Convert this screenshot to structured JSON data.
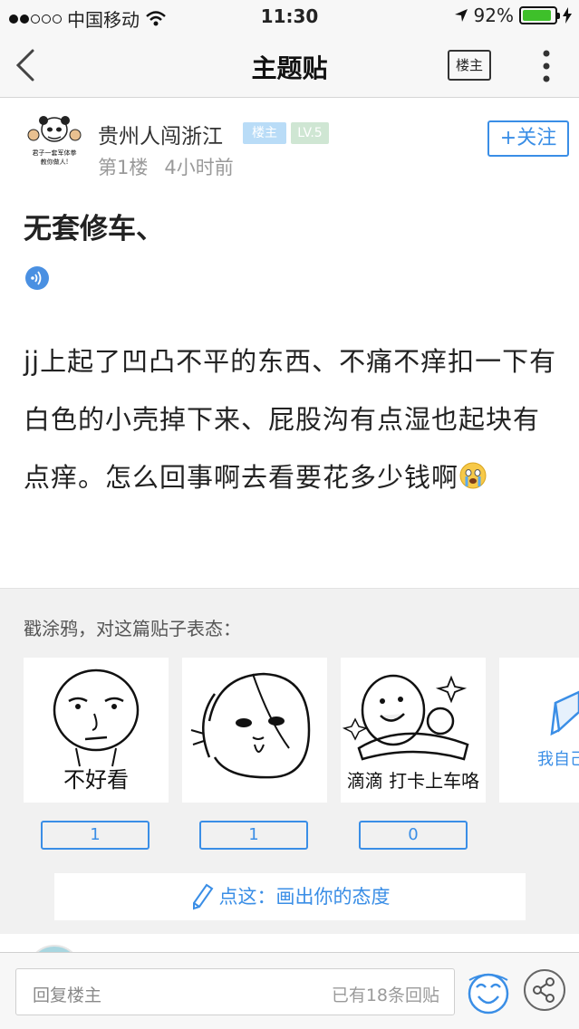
{
  "status_bar": {
    "carrier": "中国移动",
    "time": "11:30",
    "battery_percent": "92%",
    "battery_level": 0.92
  },
  "nav": {
    "title": "主题贴",
    "louzhu_filter": "楼主"
  },
  "post": {
    "author": "贵州人闯浙江",
    "badge_owner": "楼主",
    "badge_level": "LV.5",
    "floor": "第1楼",
    "time": "4小时前",
    "follow": "+关注",
    "avatar_caption_1": "君子一套军体拳",
    "avatar_caption_2": "教你做人!",
    "title": "无套修车、",
    "body": "jj上起了凹凸不平的东西、不痛不痒扣一下有白色的小壳掉下来、屁股沟有点湿也起块有点痒。怎么回事啊去看要花多少钱啊"
  },
  "doodle": {
    "label": "戳涂鸦，对这篇贴子表态：",
    "cards": [
      {
        "caption": "不好看",
        "count": "1"
      },
      {
        "caption": "",
        "count": "1"
      },
      {
        "caption": "滴滴 打卡上车咯",
        "count": "0"
      },
      {
        "caption": "我自己"
      }
    ],
    "draw_button": "点这：画出你的态度"
  },
  "bottom": {
    "reply_placeholder": "回复楼主",
    "reply_count": "已有18条回贴"
  },
  "colors": {
    "accent": "#3a8ee6",
    "battery": "#3ec02a"
  }
}
